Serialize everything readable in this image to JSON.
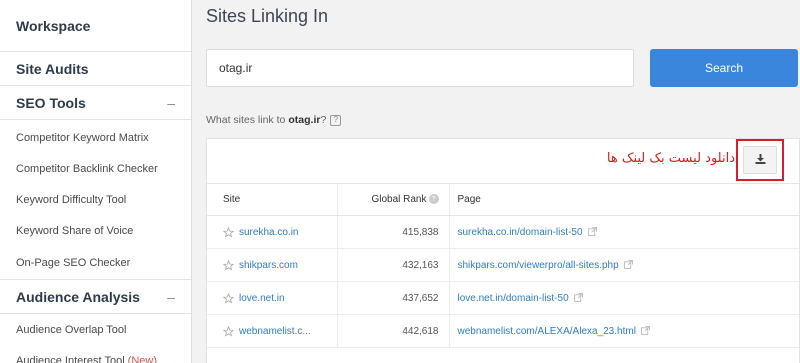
{
  "sidebar": {
    "sections": [
      {
        "label": "Workspace",
        "toggle": ""
      },
      {
        "label": "Site Audits",
        "toggle": ""
      },
      {
        "label": "SEO Tools",
        "toggle": "–"
      },
      {
        "label": "Audience Analysis",
        "toggle": "–"
      }
    ],
    "seo_items": [
      "Competitor Keyword Matrix",
      "Competitor Backlink Checker",
      "Keyword Difficulty Tool",
      "Keyword Share of Voice",
      "On-Page SEO Checker"
    ],
    "audience_items": [
      {
        "label": "Audience Overlap Tool",
        "badge": ""
      },
      {
        "label": "Audience Interest Tool",
        "badge": "(New)"
      }
    ]
  },
  "main": {
    "title": "Sites Linking In",
    "search": {
      "value": "otag.ir",
      "button_label": "Search"
    },
    "question": {
      "prefix": "What sites link to",
      "domain": "otag.ir",
      "suffix": "?",
      "help_icon": "?"
    },
    "annotation_text": "دانلود لیست بک لینک ها",
    "export_icon": "download-icon",
    "table": {
      "headers": {
        "site": "Site",
        "rank": "Global Rank",
        "page": "Page"
      },
      "rows": [
        {
          "site": "surekha.co.in",
          "rank": "415,838",
          "page": "surekha.co.in/domain-list-50"
        },
        {
          "site": "shikpars.com",
          "rank": "432,163",
          "page": "shikpars.com/viewerpro/all-sites.php"
        },
        {
          "site": "love.net.in",
          "rank": "437,652",
          "page": "love.net.in/domain-list-50"
        },
        {
          "site": "webnamelist.c...",
          "rank": "442,618",
          "page": "webnamelist.com/ALEXA/Alexa_23.html"
        }
      ]
    }
  },
  "colors": {
    "accent": "#3b86dd",
    "link": "#2d7dc9",
    "annotation": "#d91c1c"
  }
}
